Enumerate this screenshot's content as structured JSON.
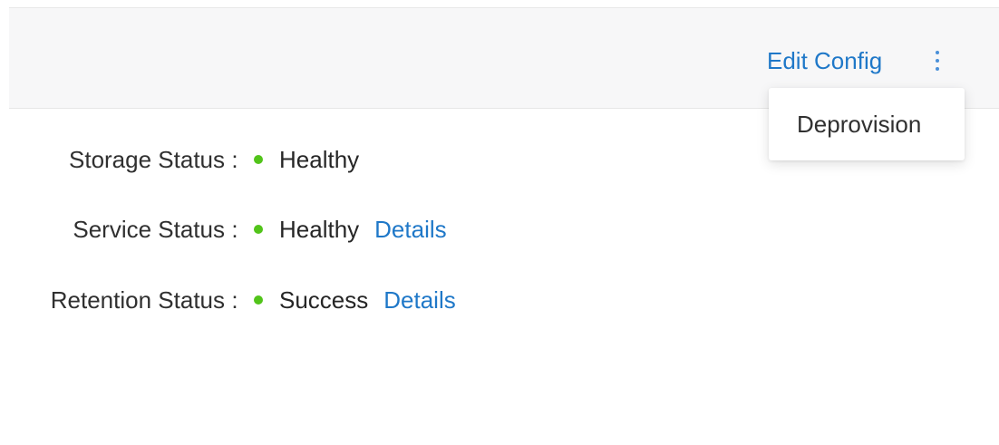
{
  "header": {
    "edit_config_label": "Edit Config",
    "more_menu_icon": "more-vertical-icon"
  },
  "menu": {
    "items": [
      {
        "label": "Deprovision"
      }
    ]
  },
  "colors": {
    "accent": "#1f78c8",
    "status_ok": "#52c41a",
    "header_bg": "#f7f7f8"
  },
  "statuses": [
    {
      "label": "Storage Status",
      "colon": ":",
      "value": "Healthy",
      "link": ""
    },
    {
      "label": "Service Status",
      "colon": ":",
      "value": "Healthy",
      "link": "Details"
    },
    {
      "label": "Retention Status",
      "colon": ":",
      "value": "Success",
      "link": "Details"
    }
  ]
}
